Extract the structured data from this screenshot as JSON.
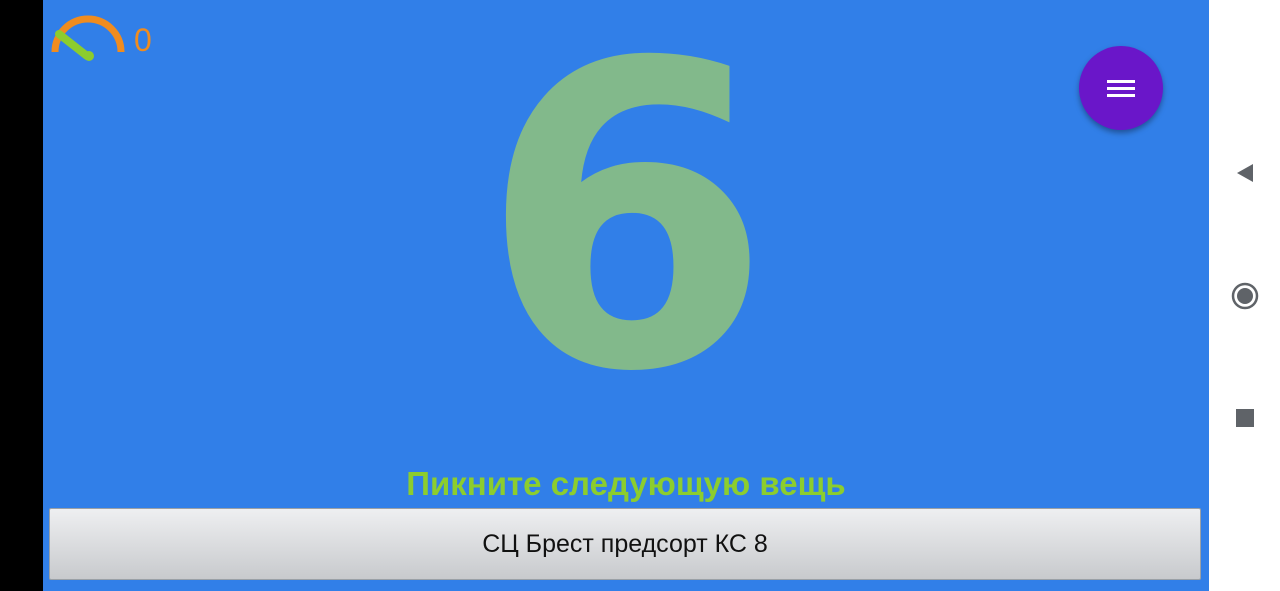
{
  "gauge": {
    "icon": "speedometer-icon",
    "value": "0",
    "value_color": "#f08c1f"
  },
  "main": {
    "counter": "6",
    "prompt": "Пикните следующую вещь",
    "background_color": "#317fe8",
    "counter_color": "#82b98b",
    "prompt_color": "#8ccd2e"
  },
  "fab": {
    "icon": "menu-icon",
    "color": "#6a16c9"
  },
  "bottom_button": {
    "label": "СЦ Брест предсорт КС 8"
  },
  "system_nav": {
    "back_icon": "back-triangle-icon",
    "home_icon": "home-circle-icon",
    "recents_icon": "recents-square-icon"
  }
}
